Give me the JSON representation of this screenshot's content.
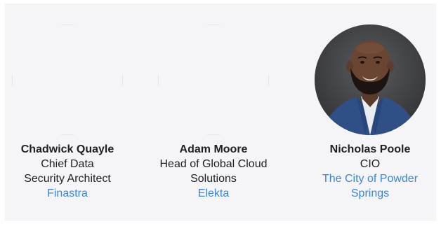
{
  "speakers": [
    {
      "name": "Chadwick Quayle",
      "title": "Chief Data Security Architect",
      "company": "Finastra",
      "photo": "photo-placeholder"
    },
    {
      "name": "Adam Moore",
      "title": "Head of Global Cloud Solutions",
      "company": "Elekta",
      "photo": "photo-placeholder"
    },
    {
      "name": "Nicholas Poole",
      "title": "CIO",
      "company": "The City of Powder Springs",
      "photo": "headshot-man-beard-blue-suit"
    }
  ],
  "colors": {
    "panel": "#f5f5f7",
    "link": "#3a86d8",
    "text": "#1f1f23"
  }
}
